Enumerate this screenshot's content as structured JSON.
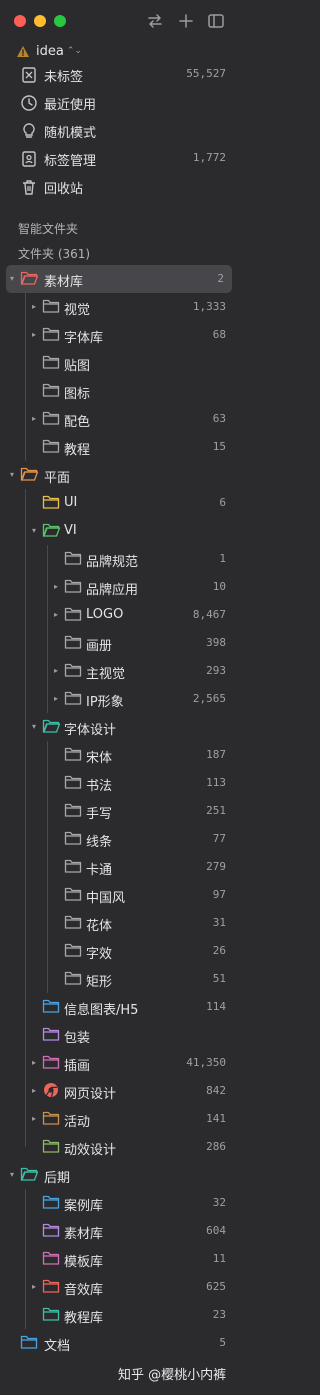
{
  "library": {
    "name": "idea"
  },
  "system_items": [
    {
      "label": "未标签",
      "count": "55,527",
      "icon": "untagged-icon"
    },
    {
      "label": "最近使用",
      "count": "",
      "icon": "clock-icon"
    },
    {
      "label": "随机模式",
      "count": "",
      "icon": "lightbulb-icon"
    },
    {
      "label": "标签管理",
      "count": "1,772",
      "icon": "tag-manager-icon"
    },
    {
      "label": "回收站",
      "count": "",
      "icon": "trash-icon"
    }
  ],
  "sections": {
    "smart_folders": "智能文件夹",
    "folders": "文件夹 (361)"
  },
  "colors": {
    "red": "#e8665c",
    "orange": "#e5944a",
    "yellow": "#e6c04d",
    "green": "#5cc36a",
    "teal": "#3fbfa6",
    "blue": "#4aa3e0",
    "purple": "#b58ae0",
    "pink": "#d06fb3",
    "brown": "#c99050",
    "olive": "#8db86a",
    "gray": "#a8a8ac"
  },
  "tree": [
    {
      "name": "素材库",
      "count": "2",
      "level": 0,
      "expanded": true,
      "color": "red",
      "selected": true
    },
    {
      "name": "视觉",
      "count": "1,333",
      "level": 1,
      "collapsed": true,
      "color": "gray"
    },
    {
      "name": "字体库",
      "count": "68",
      "level": 1,
      "collapsed": true,
      "color": "gray"
    },
    {
      "name": "贴图",
      "count": "",
      "level": 1,
      "color": "gray"
    },
    {
      "name": "图标",
      "count": "",
      "level": 1,
      "color": "gray"
    },
    {
      "name": "配色",
      "count": "63",
      "level": 1,
      "collapsed": true,
      "color": "gray"
    },
    {
      "name": "教程",
      "count": "15",
      "level": 1,
      "color": "gray"
    },
    {
      "name": "平面",
      "count": "",
      "level": 0,
      "expanded": true,
      "color": "orange"
    },
    {
      "name": "UI",
      "count": "6",
      "level": 1,
      "color": "yellow"
    },
    {
      "name": "VI",
      "count": "",
      "level": 1,
      "expanded": true,
      "color": "green"
    },
    {
      "name": "品牌规范",
      "count": "1",
      "level": 2,
      "color": "gray"
    },
    {
      "name": "品牌应用",
      "count": "10",
      "level": 2,
      "collapsed": true,
      "color": "gray"
    },
    {
      "name": "LOGO",
      "count": "8,467",
      "level": 2,
      "collapsed": true,
      "color": "gray"
    },
    {
      "name": "画册",
      "count": "398",
      "level": 2,
      "color": "gray"
    },
    {
      "name": "主视觉",
      "count": "293",
      "level": 2,
      "collapsed": true,
      "color": "gray"
    },
    {
      "name": "IP形象",
      "count": "2,565",
      "level": 2,
      "collapsed": true,
      "color": "gray"
    },
    {
      "name": "字体设计",
      "count": "",
      "level": 1,
      "expanded": true,
      "color": "teal"
    },
    {
      "name": "宋体",
      "count": "187",
      "level": 2,
      "color": "gray"
    },
    {
      "name": "书法",
      "count": "113",
      "level": 2,
      "color": "gray"
    },
    {
      "name": "手写",
      "count": "251",
      "level": 2,
      "color": "gray"
    },
    {
      "name": "线条",
      "count": "77",
      "level": 2,
      "color": "gray"
    },
    {
      "name": "卡通",
      "count": "279",
      "level": 2,
      "color": "gray"
    },
    {
      "name": "中国风",
      "count": "97",
      "level": 2,
      "color": "gray"
    },
    {
      "name": "花体",
      "count": "31",
      "level": 2,
      "color": "gray"
    },
    {
      "name": "字效",
      "count": "26",
      "level": 2,
      "color": "gray"
    },
    {
      "name": "矩形",
      "count": "51",
      "level": 2,
      "color": "gray"
    },
    {
      "name": "信息图表/H5",
      "count": "114",
      "level": 1,
      "color": "blue"
    },
    {
      "name": "包装",
      "count": "",
      "level": 1,
      "color": "purple"
    },
    {
      "name": "插画",
      "count": "41,350",
      "level": 1,
      "collapsed": true,
      "color": "pink"
    },
    {
      "name": "网页设计",
      "count": "842",
      "level": 1,
      "collapsed": true,
      "color": "red",
      "special": "chrome"
    },
    {
      "name": "活动",
      "count": "141",
      "level": 1,
      "collapsed": true,
      "color": "brown"
    },
    {
      "name": "动效设计",
      "count": "286",
      "level": 1,
      "color": "olive"
    },
    {
      "name": "后期",
      "count": "",
      "level": 0,
      "expanded": true,
      "color": "teal"
    },
    {
      "name": "案例库",
      "count": "32",
      "level": 1,
      "color": "blue"
    },
    {
      "name": "素材库",
      "count": "604",
      "level": 1,
      "color": "purple"
    },
    {
      "name": "模板库",
      "count": "11",
      "level": 1,
      "color": "pink"
    },
    {
      "name": "音效库",
      "count": "625",
      "level": 1,
      "collapsed": true,
      "color": "red"
    },
    {
      "name": "教程库",
      "count": "23",
      "level": 1,
      "color": "teal"
    },
    {
      "name": "文档",
      "count": "5",
      "level": 0,
      "color": "blue"
    }
  ],
  "watermark": "知乎 @樱桃小内裤"
}
